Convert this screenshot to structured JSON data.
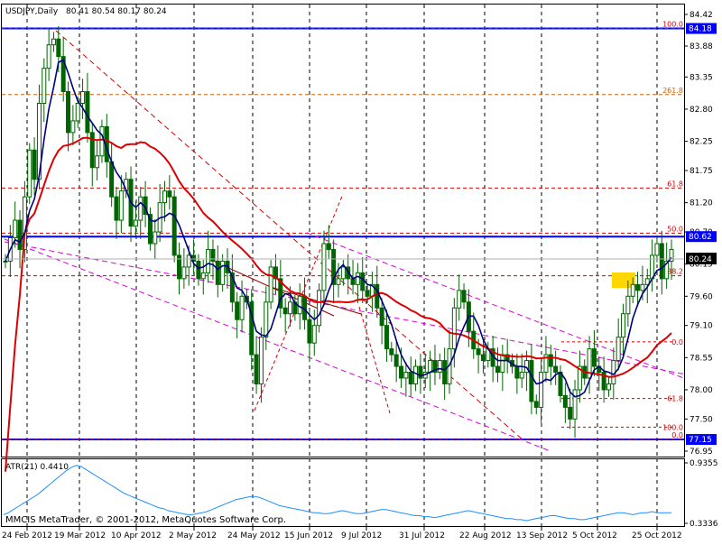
{
  "window": {
    "title": "USDJPY,Daily",
    "ohlc": "80.41 80.54 80.17 80.24",
    "copyright": "MMCIS MetaTrader, © 2001-2012, MetaQuotes Software Corp."
  },
  "chart_data": {
    "type": "candlestick",
    "symbol": "USDJPY",
    "timeframe": "Daily",
    "x_tick_labels": [
      "24 Feb 2012",
      "19 Mar 2012",
      "10 Apr 2012",
      "2 May 2012",
      "24 May 2012",
      "15 Jun 2012",
      "9 Jul 2012",
      "31 Jul 2012",
      "22 Aug 2012",
      "13 Sep 2012",
      "5 Oct 2012",
      "25 Oct 2012"
    ],
    "ylim": [
      76.95,
      84.42
    ],
    "y_ticks": [
      "84.42",
      "83.88",
      "83.35",
      "82.80",
      "82.25",
      "81.75",
      "81.20",
      "80.70",
      "80.15",
      "79.60",
      "79.10",
      "78.55",
      "78.00",
      "77.50",
      "76.95"
    ],
    "last_price": "80.24",
    "level_labels": [
      "84.18",
      "80.62",
      "77.15"
    ],
    "horizontal_levels": [
      {
        "value": 84.18,
        "label": "84.18",
        "color": "#0000ff",
        "style": "solid"
      },
      {
        "value": 80.62,
        "label": "80.62",
        "color": "#0000ff",
        "style": "solid"
      },
      {
        "value": 77.15,
        "label": "77.15",
        "color": "#0000ff",
        "style": "solid"
      }
    ],
    "fib_big": [
      {
        "value": 84.18,
        "label": "100.0",
        "color": "#d80000"
      },
      {
        "value": 83.05,
        "label": "261.8",
        "color": "#d86000"
      },
      {
        "value": 81.45,
        "label": "61.8",
        "color": "#d80000"
      },
      {
        "value": 80.68,
        "label": "50.0",
        "color": "#d80000"
      },
      {
        "value": 79.95,
        "label": "38.2",
        "color": "#d80000"
      },
      {
        "value": 77.15,
        "label": "0.0",
        "color": "#d80000"
      }
    ],
    "fib_small": [
      {
        "value": 78.82,
        "label": "0.0"
      },
      {
        "value": 77.85,
        "label": "61.8"
      },
      {
        "value": 77.36,
        "label": "100.0"
      }
    ],
    "close_series": [
      80.2,
      80.6,
      80.9,
      80.4,
      81.3,
      82.1,
      81.6,
      82.9,
      83.5,
      83.9,
      84.0,
      83.7,
      83.1,
      82.4,
      82.6,
      82.9,
      83.1,
      82.4,
      81.8,
      82.0,
      82.5,
      81.9,
      81.3,
      80.9,
      81.4,
      81.6,
      80.8,
      80.9,
      81.3,
      81.0,
      80.5,
      80.7,
      81.2,
      81.4,
      81.3,
      80.3,
      79.9,
      80.1,
      80.3,
      80.2,
      79.9,
      80.0,
      80.4,
      80.2,
      79.8,
      80.2,
      80.0,
      79.5,
      79.2,
      79.6,
      79.5,
      78.6,
      78.1,
      78.9,
      79.5,
      80.1,
      79.9,
      79.4,
      79.3,
      79.5,
      79.3,
      79.6,
      79.2,
      78.8,
      79.1,
      79.7,
      80.5,
      80.4,
      79.8,
      79.9,
      80.1,
      79.9,
      79.8,
      80.0,
      79.7,
      79.6,
      79.8,
      79.4,
      79.1,
      78.7,
      78.6,
      78.4,
      78.2,
      78.3,
      78.1,
      78.4,
      78.2,
      78.3,
      78.5,
      78.3,
      78.5,
      78.1,
      78.7,
      79.4,
      79.7,
      79.5,
      79.0,
      78.7,
      78.6,
      78.5,
      78.7,
      78.4,
      78.3,
      78.6,
      78.5,
      78.4,
      78.2,
      78.3,
      78.5,
      77.8,
      77.7,
      78.3,
      78.6,
      78.4,
      78.3,
      77.9,
      77.7,
      77.5,
      78.0,
      78.4,
      78.2,
      78.7,
      78.4,
      78.3,
      78.0,
      78.1,
      78.5,
      78.9,
      79.3,
      79.6,
      79.8,
      79.7,
      79.8,
      79.9,
      80.3,
      80.5,
      79.9,
      80.2,
      80.4
    ],
    "ma_fast_color": "#000080",
    "ma_slow_color": "#dd0000",
    "candle_color": "#006400",
    "atr": {
      "label": "ATR(21) 0.4410",
      "ylim": [
        0.3336,
        0.9355
      ],
      "y_ticks": [
        "0.9355",
        "0.3336"
      ],
      "color": "#1e90ff",
      "values": [
        0.42,
        0.44,
        0.47,
        0.5,
        0.53,
        0.56,
        0.59,
        0.62,
        0.66,
        0.7,
        0.74,
        0.78,
        0.82,
        0.86,
        0.89,
        0.91,
        0.9,
        0.87,
        0.84,
        0.81,
        0.78,
        0.75,
        0.72,
        0.69,
        0.66,
        0.63,
        0.61,
        0.59,
        0.57,
        0.55,
        0.53,
        0.51,
        0.49,
        0.48,
        0.46,
        0.45,
        0.44,
        0.43,
        0.42,
        0.42,
        0.43,
        0.44,
        0.45,
        0.47,
        0.49,
        0.51,
        0.53,
        0.55,
        0.57,
        0.58,
        0.59,
        0.6,
        0.6,
        0.59,
        0.57,
        0.55,
        0.53,
        0.51,
        0.5,
        0.49,
        0.48,
        0.47,
        0.46,
        0.45,
        0.44,
        0.44,
        0.43,
        0.43,
        0.44,
        0.45,
        0.46,
        0.45,
        0.44,
        0.43,
        0.43,
        0.44,
        0.45,
        0.46,
        0.47,
        0.47,
        0.46,
        0.45,
        0.44,
        0.43,
        0.42,
        0.41,
        0.41,
        0.4,
        0.4,
        0.39,
        0.4,
        0.41,
        0.42,
        0.43,
        0.44,
        0.45,
        0.46,
        0.45,
        0.44,
        0.43,
        0.42,
        0.41,
        0.4,
        0.39,
        0.38,
        0.38,
        0.37,
        0.37,
        0.36,
        0.37,
        0.38,
        0.39,
        0.4,
        0.41,
        0.41,
        0.4,
        0.39,
        0.38,
        0.38,
        0.37,
        0.37,
        0.38,
        0.39,
        0.4,
        0.41,
        0.42,
        0.43,
        0.44,
        0.44,
        0.43,
        0.42,
        0.43,
        0.44,
        0.44,
        0.45,
        0.44,
        0.44,
        0.44,
        0.44
      ]
    }
  }
}
